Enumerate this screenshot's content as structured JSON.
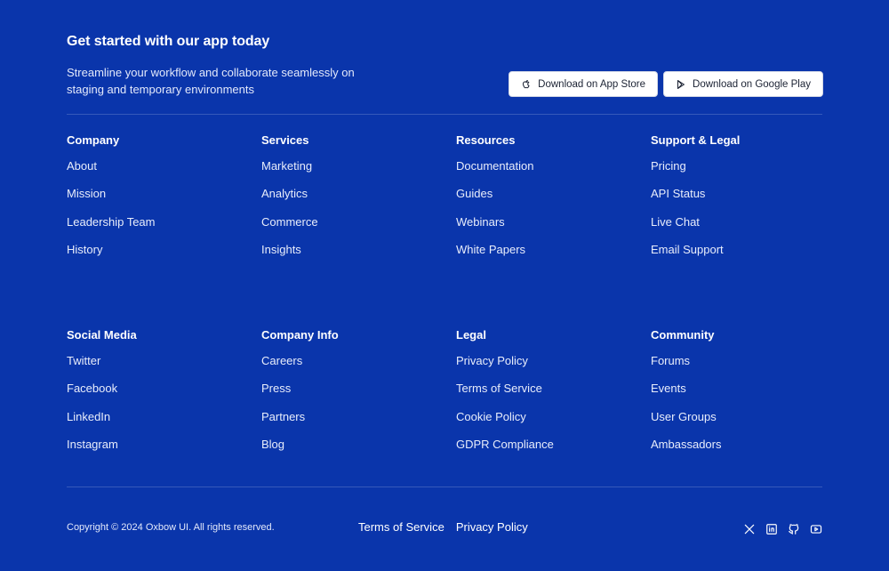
{
  "cta": {
    "title": "Get started with our app today",
    "subtitle": "Streamline your workflow and collaborate seamlessly on staging and temporary environments",
    "app_store_label": "Download on App Store",
    "app_store_icon": "apple-icon",
    "google_play_label": "Download on Google Play",
    "google_play_icon": "play-icon"
  },
  "sections_top": [
    {
      "title": "Company",
      "links": [
        "About",
        "Mission",
        "Leadership Team",
        "History"
      ]
    },
    {
      "title": "Services",
      "links": [
        "Marketing",
        "Analytics",
        "Commerce",
        "Insights"
      ]
    },
    {
      "title": "Resources",
      "links": [
        "Documentation",
        "Guides",
        "Webinars",
        "White Papers"
      ]
    },
    {
      "title": "Support & Legal",
      "links": [
        "Pricing",
        "API Status",
        "Live Chat",
        "Email Support"
      ]
    }
  ],
  "sections_bottom": [
    {
      "title": "Social Media",
      "links": [
        "Twitter",
        "Facebook",
        "LinkedIn",
        "Instagram"
      ]
    },
    {
      "title": "Company Info",
      "links": [
        "Careers",
        "Press",
        "Partners",
        "Blog"
      ]
    },
    {
      "title": "Legal",
      "links": [
        "Privacy Policy",
        "Terms of Service",
        "Cookie Policy",
        "GDPR Compliance"
      ]
    },
    {
      "title": "Community",
      "links": [
        "Forums",
        "Events",
        "User Groups",
        "Ambassadors"
      ]
    }
  ],
  "bottom": {
    "copyright": "Copyright © 2024 Oxbow UI. All rights reserved.",
    "terms_label": "Terms of Service",
    "privacy_label": "Privacy Policy",
    "social_icons": [
      "x-icon",
      "linkedin-icon",
      "github-icon",
      "youtube-icon"
    ]
  },
  "colors": {
    "background": "#0a35ab",
    "text": "#ffffff",
    "button_bg": "#ffffff",
    "button_text": "#1b2233"
  }
}
